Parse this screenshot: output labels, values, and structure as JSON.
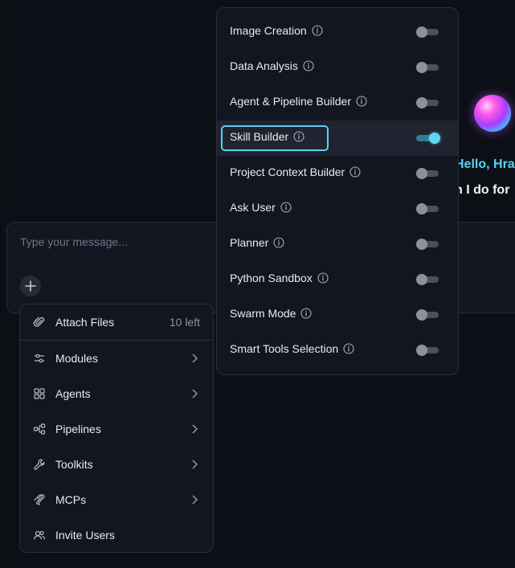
{
  "greeting": {
    "hello": "Hello, Hra",
    "sub": "n I do for"
  },
  "chat": {
    "placeholder": "Type your message..."
  },
  "add_menu": {
    "items": [
      {
        "label": "Attach Files",
        "right": "10 left",
        "icon": "paperclip-icon"
      },
      {
        "label": "Modules",
        "icon": "sliders-icon"
      },
      {
        "label": "Agents",
        "icon": "grid-icon"
      },
      {
        "label": "Pipelines",
        "icon": "pipeline-icon"
      },
      {
        "label": "Toolkits",
        "icon": "wrench-icon"
      },
      {
        "label": "MCPs",
        "icon": "mcp-icon"
      },
      {
        "label": "Invite Users",
        "icon": "users-icon"
      }
    ]
  },
  "modules": {
    "items": [
      {
        "label": "Image Creation",
        "enabled": false
      },
      {
        "label": "Data Analysis",
        "enabled": false
      },
      {
        "label": "Agent & Pipeline Builder",
        "enabled": false
      },
      {
        "label": "Skill Builder",
        "enabled": true
      },
      {
        "label": "Project Context Builder",
        "enabled": false
      },
      {
        "label": "Ask User",
        "enabled": false
      },
      {
        "label": "Planner",
        "enabled": false
      },
      {
        "label": "Python Sandbox",
        "enabled": false
      },
      {
        "label": "Swarm Mode",
        "enabled": false
      },
      {
        "label": "Smart Tools Selection",
        "enabled": false
      }
    ]
  },
  "colors": {
    "accent": "#5fd6f5",
    "background": "#0c0f16",
    "panel": "#121620"
  }
}
